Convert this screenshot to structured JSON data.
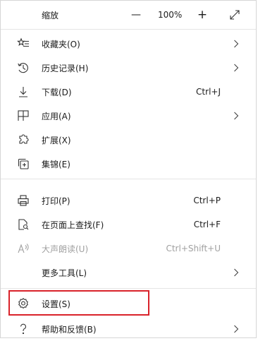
{
  "zoom": {
    "label": "缩放",
    "minus": "—",
    "value": "100%",
    "plus": "+"
  },
  "items": [
    {
      "label": "收藏夹(O)",
      "icon": "favorites-icon"
    },
    {
      "label": "历史记录(H)",
      "icon": "history-icon"
    },
    {
      "label": "下载(D)",
      "shortcut": "Ctrl+J",
      "icon": "download-icon"
    },
    {
      "label": "应用(A)",
      "icon": "apps-icon"
    },
    {
      "label": "扩展(X)",
      "icon": "extensions-icon"
    },
    {
      "label": "集锦(E)",
      "icon": "collections-icon"
    },
    {
      "label": "打印(P)",
      "shortcut": "Ctrl+P",
      "icon": "print-icon"
    },
    {
      "label": "在页面上查找(F)",
      "shortcut": "Ctrl+F",
      "icon": "find-icon"
    },
    {
      "label": "大声朗读(U)",
      "shortcut": "Ctrl+Shift+U",
      "icon": "read-aloud-icon"
    },
    {
      "label": "更多工具(L)"
    },
    {
      "label": "设置(S)",
      "icon": "settings-icon"
    },
    {
      "label": "帮助和反馈(B)",
      "icon": "help-icon"
    }
  ],
  "colors": {
    "highlight": "#d9222a",
    "disabled": "#a0a0a0",
    "separator": "#e5e5e5"
  }
}
